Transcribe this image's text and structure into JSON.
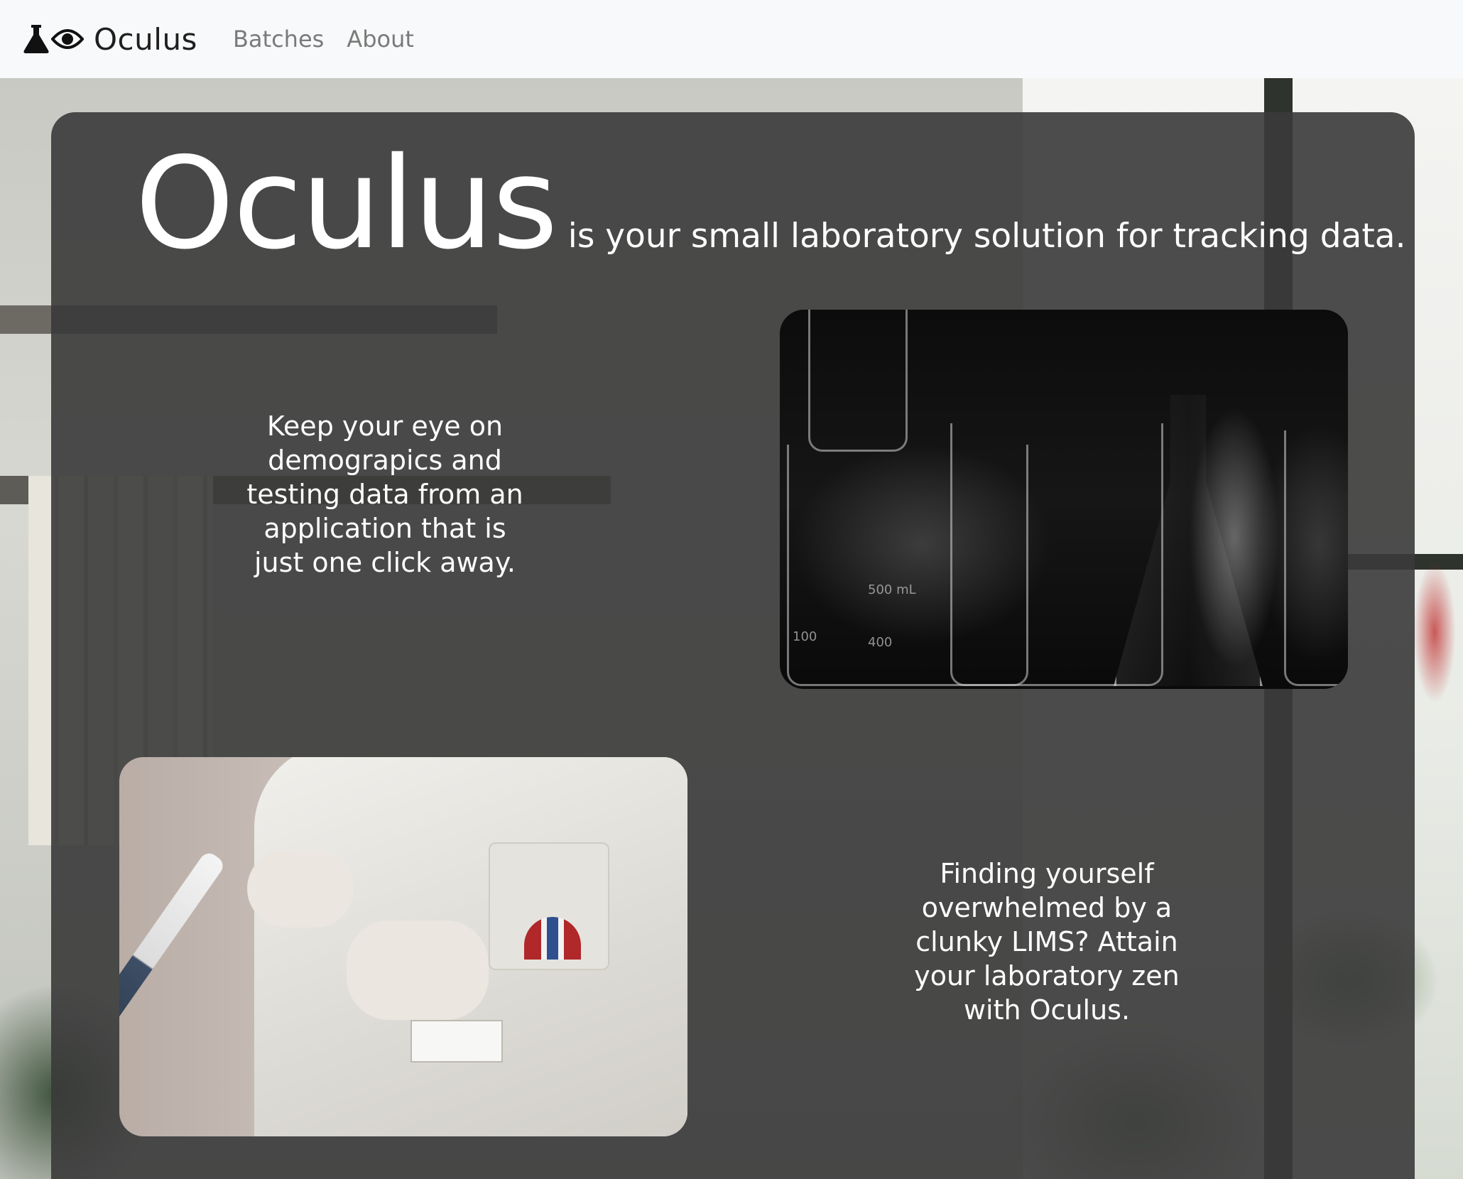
{
  "navbar": {
    "brand": "Oculus",
    "brand_icons": [
      "flask-icon",
      "eye-icon"
    ],
    "links": [
      "Batches",
      "About"
    ]
  },
  "hero": {
    "title": "Oculus",
    "tagline": "is your small laboratory solution for tracking data.",
    "feature_1": "Keep your eye on demograpics and testing data from an application that is just one click away.",
    "feature_2": "Finding yourself overwhelmed by a clunky LIMS? Attain your laboratory zen with Oculus.",
    "images": [
      "glassware-photo",
      "scientist-photo"
    ]
  },
  "colors": {
    "navbar_bg": "#f8f9fa",
    "card_bg": "#3a3a3a",
    "text": "#ffffff",
    "nav_link": "#7a7a7a"
  }
}
